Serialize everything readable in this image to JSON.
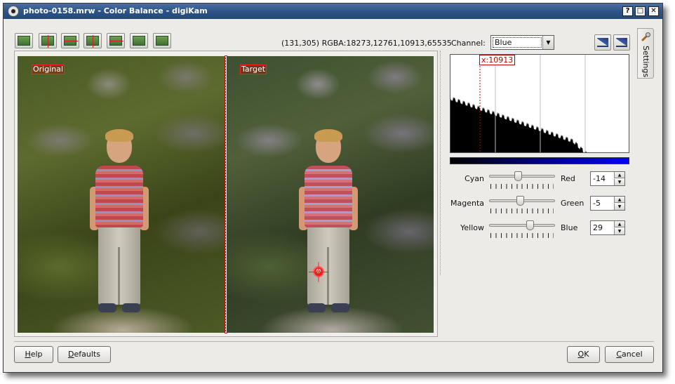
{
  "window": {
    "title": "photo-0158.mrw - Color Balance - digiKam",
    "controls": {
      "help": "?",
      "maximize": "□",
      "close": "✕"
    }
  },
  "toolbar": {
    "tools": [
      {
        "name": "original-image-icon"
      },
      {
        "name": "split-vertical-icon"
      },
      {
        "name": "split-horizontal-icon"
      },
      {
        "name": "duplicate-vertical-icon"
      },
      {
        "name": "duplicate-horizontal-icon"
      },
      {
        "name": "target-image-icon"
      },
      {
        "name": "compare-pointer-icon"
      }
    ],
    "pixel_info": "(131,305) RGBA:18273,12761,10913,65535"
  },
  "preview": {
    "original_label": "Original",
    "target_label": "Target",
    "marker_glyph": "⊗"
  },
  "channel": {
    "label": "Channel:",
    "selected": "Blue"
  },
  "histogram": {
    "cursor_label": "x:10913",
    "scale_buttons": [
      "linear-scale-icon",
      "logarithmic-scale-icon"
    ]
  },
  "sliders": [
    {
      "left": "Cyan",
      "right": "Red",
      "value": "-14",
      "position": 0.43
    },
    {
      "left": "Magenta",
      "right": "Green",
      "value": "-5",
      "position": 0.47
    },
    {
      "left": "Yellow",
      "right": "Blue",
      "value": "29",
      "position": 0.64
    }
  ],
  "side_tab": {
    "label": "Settings",
    "icon": "wrench-icon"
  },
  "buttons": {
    "help": {
      "accel": "H",
      "rest": "elp"
    },
    "defaults": {
      "accel": "D",
      "rest": "efaults"
    },
    "ok": {
      "accel": "O",
      "rest": "K"
    },
    "cancel": {
      "accel": "C",
      "rest": "ancel"
    }
  },
  "colors": {
    "titlebar": "#2c5286",
    "label_border": "#ff2020",
    "histogram_cursor": "#c00000",
    "channel_gradient_end": "#0000ff"
  }
}
